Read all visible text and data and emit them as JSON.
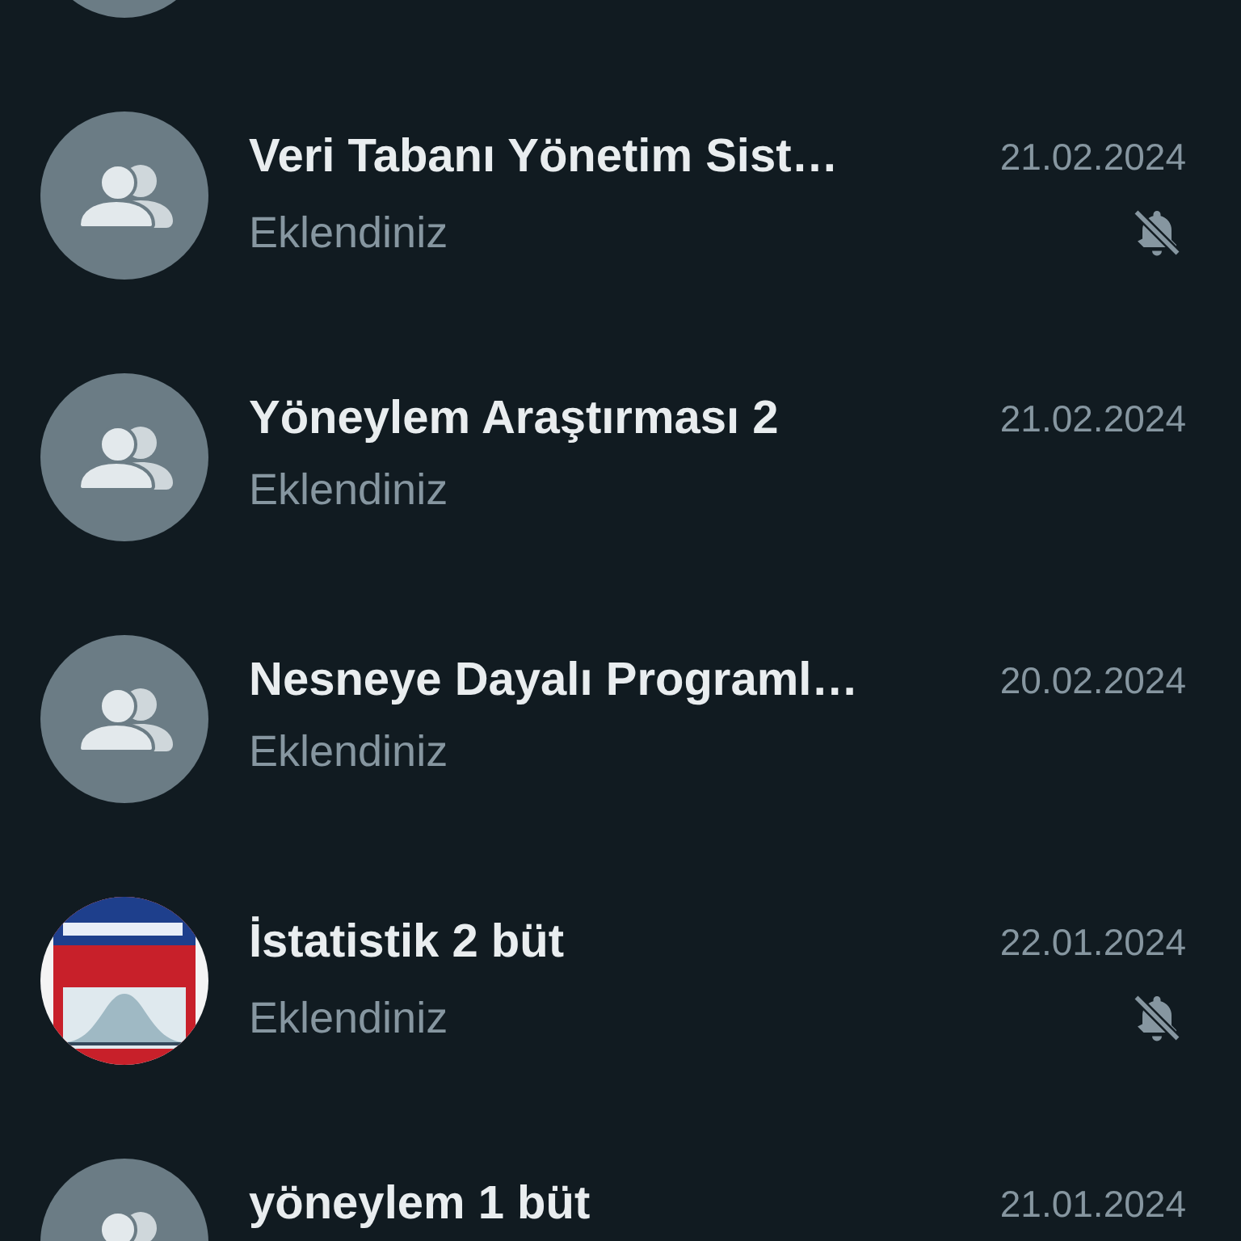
{
  "chats": [
    {
      "kind": "group"
    },
    {
      "kind": "group",
      "title": "Veri Tabanı Yönetim Sist…",
      "date": "21.02.2024",
      "preview": "Eklendiniz",
      "muted": true
    },
    {
      "kind": "group",
      "title": "Yöneylem Araştırması 2",
      "date": "21.02.2024",
      "preview": "Eklendiniz",
      "muted": false
    },
    {
      "kind": "group",
      "title": "Nesneye Dayalı Programl…",
      "date": "20.02.2024",
      "preview": "Eklendiniz",
      "muted": false
    },
    {
      "kind": "picture",
      "title": "İstatistik 2 büt",
      "date": "22.01.2024",
      "preview": "Eklendiniz",
      "muted": true
    },
    {
      "kind": "group",
      "title": "yöneylem 1 büt",
      "date": "21.01.2024"
    }
  ]
}
